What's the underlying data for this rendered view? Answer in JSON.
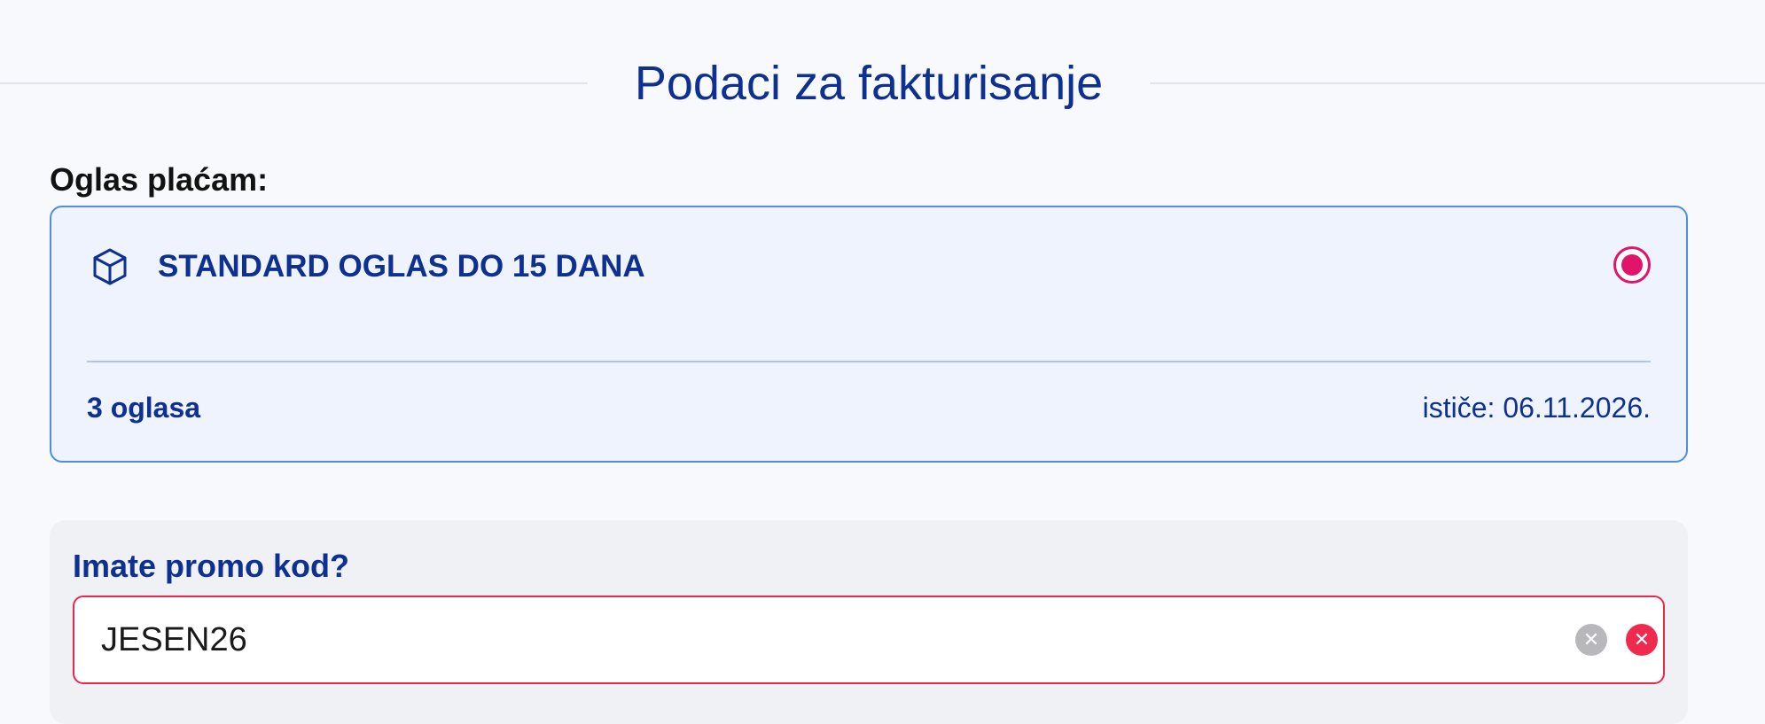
{
  "header": {
    "title": "Podaci za fakturisanje"
  },
  "payment": {
    "label": "Oglas plaćam:",
    "selected_plan": {
      "icon": "package-cube-icon",
      "name": "STANDARD OGLAS DO 15 DANA",
      "count": "3 oglasa",
      "expiry": "ističe: 06.11.2026.",
      "selected": true
    }
  },
  "promo": {
    "label": "Imate promo kod?",
    "value": "JESEN26",
    "status": "error",
    "clear_icon": "clear-icon",
    "error_icon": "error-icon"
  },
  "colors": {
    "brand": "#0e3191",
    "accent": "#e0146a",
    "card_border": "#4d8ee0",
    "error": "#e8294d"
  }
}
